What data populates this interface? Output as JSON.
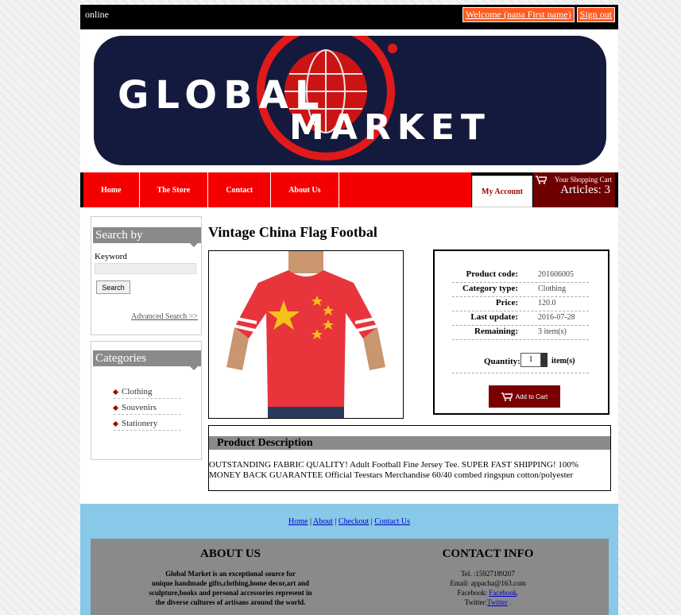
{
  "topbar": {
    "status": "online",
    "welcome": "Welcome (nana First name)",
    "signout": "Sign out"
  },
  "nav": {
    "items": [
      "Home",
      "The Store",
      "Contact",
      "About Us"
    ],
    "account": "My Account",
    "cart_label": "Your Shopping Cart",
    "cart_count": "Articles: 3"
  },
  "logo": {
    "line1": "GLOBAL",
    "line2": "MARKET"
  },
  "search": {
    "title": "Search by",
    "keyword_label": "Keyword",
    "keyword_value": "",
    "button": "Search",
    "advanced": "Advanced Search >>"
  },
  "categories": {
    "title": "Categories",
    "items": [
      "Clothing",
      "Souvenirs",
      "Stationery"
    ]
  },
  "product": {
    "title": "Vintage China Flag Footbal",
    "rows": [
      {
        "k": "Product code:",
        "v": "201606005"
      },
      {
        "k": "Category type:",
        "v": "Clothing"
      },
      {
        "k": "Price:",
        "v": "120.0"
      },
      {
        "k": "Last update:",
        "v": "2016-07-28"
      },
      {
        "k": "Remaining:",
        "v": "3  item(s)"
      }
    ],
    "quantity_label": "Quantity:",
    "quantity_value": "1",
    "quantity_unit": "item(s)",
    "add_button": "Add to Cart",
    "description_title": "Product Description",
    "description": "OUTSTANDING FABRIC QUALITY! Adult Football Fine Jersey Tee. SUPER FAST SHIPPING! 100% MONEY BACK GUARANTEE Official Teestars Merchandise 60/40 combed ringspun cotton/polyester"
  },
  "footer": {
    "links": [
      "Home",
      "About",
      "Checkout",
      "Contact Us"
    ],
    "about_title": "ABOUT US",
    "about_lines": [
      "Global Market is an exceptional source for",
      "unique handmade gifts,clothing,home decor,art and",
      "sculpture,books and personal accessories represent in",
      "the diverse cultures of artisans around the world."
    ],
    "contact_title": "CONTACT INFO",
    "tel": "Tel. :15927189207",
    "email": "Email: appacha@163.com",
    "facebook_label": "Facebook: ",
    "facebook_link": "Facebook",
    "twitter_label": "Twitter:",
    "twitter_link": "Twitter"
  },
  "colors": {
    "accent_red": "#f50000",
    "dark_red": "#7a0000",
    "navy": "#141a3d",
    "footer_blue": "#88c8e8"
  }
}
